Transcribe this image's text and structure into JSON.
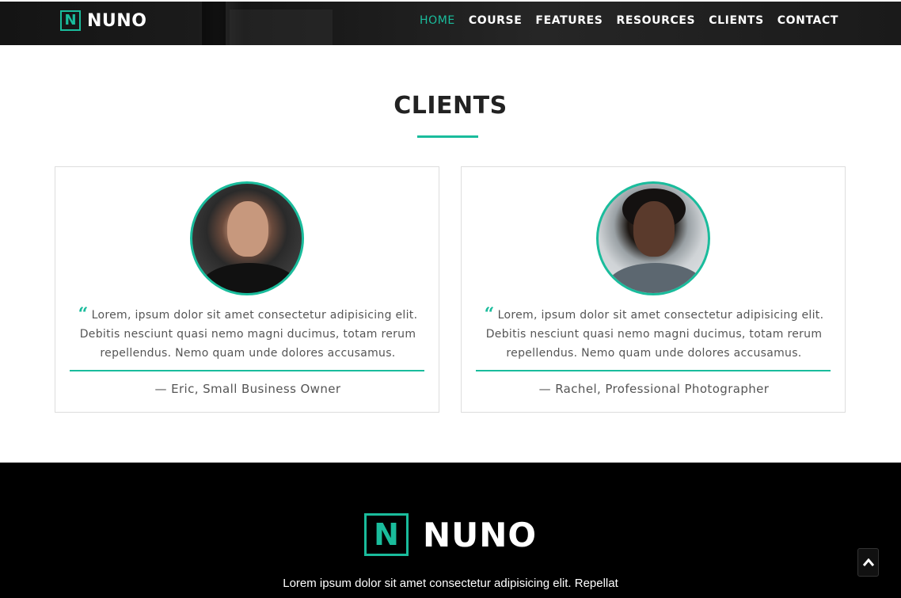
{
  "brand": {
    "mark": "N",
    "name": "NUNO"
  },
  "nav": {
    "items": [
      {
        "label": "HOME",
        "active": true
      },
      {
        "label": "COURSE"
      },
      {
        "label": "FEATURES"
      },
      {
        "label": "RESOURCES"
      },
      {
        "label": "CLIENTS"
      },
      {
        "label": "CONTACT"
      }
    ]
  },
  "clients": {
    "title": "CLIENTS",
    "cards": [
      {
        "quote": "Lorem, ipsum dolor sit amet consectetur adipisicing elit. Debitis nesciunt quasi nemo magni ducimus, totam rerum repellendus. Nemo quam unde dolores accusamus.",
        "author": "— Eric, Small Business Owner"
      },
      {
        "quote": "Lorem, ipsum dolor sit amet consectetur adipisicing elit. Debitis nesciunt quasi nemo magni ducimus, totam rerum repellendus. Nemo quam unde dolores accusamus.",
        "author": "— Rachel, Professional Photographer"
      }
    ]
  },
  "footer": {
    "brand_mark": "N",
    "brand_name": "NUNO",
    "text": "Lorem ipsum dolor sit amet consectetur adipisicing elit. Repellat"
  },
  "icons": {
    "quote": "quote-icon",
    "back_to_top": "chevron-up-icon"
  },
  "colors": {
    "accent": "#1abc9c",
    "footer_bg": "#000000"
  }
}
